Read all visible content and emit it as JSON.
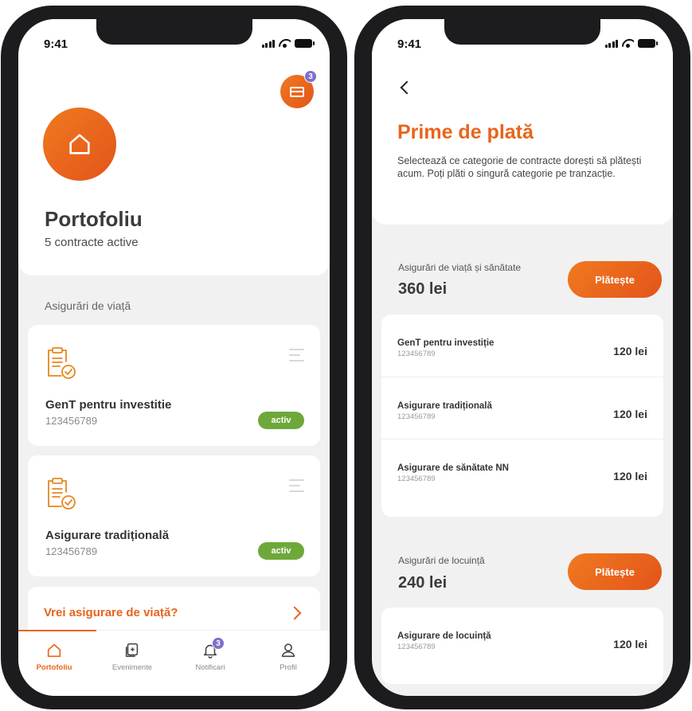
{
  "status": {
    "time": "9:41"
  },
  "portfolio": {
    "cart_badge": "3",
    "title": "Portofoliu",
    "subtitle": "5 contracte active",
    "section_label": "Asigurări de viață",
    "contracts": [
      {
        "name": "GenT pentru  investitie",
        "number": "123456789",
        "status": "activ"
      },
      {
        "name": "Asigurare tradițională",
        "number": "123456789",
        "status": "activ"
      }
    ],
    "promo_text": "Vrei asigurare de viață?",
    "tabs": [
      {
        "label": "Portofoliu",
        "icon": "home-icon",
        "active": true
      },
      {
        "label": "Evenimente",
        "icon": "document-plus-icon",
        "active": false
      },
      {
        "label": "Notificari",
        "icon": "bell-icon",
        "active": false,
        "badge": "3"
      },
      {
        "label": "Profil",
        "icon": "user-icon",
        "active": false
      }
    ]
  },
  "payments": {
    "title": "Prime de plată",
    "description": "Selectează ce categorie de contracte dorești să plătești acum. Poți plăti o singură categorie pe tranzacție.",
    "groups": [
      {
        "label": "Asigurări de viață și sănătate",
        "amount": "360 lei",
        "pay_label": "Plătește",
        "items": [
          {
            "name": "GenT pentru investiție",
            "number": "123456789",
            "amount": "120 lei"
          },
          {
            "name": "Asigurare tradițională",
            "number": "123456789",
            "amount": "120 lei"
          },
          {
            "name": "Asigurare de sănătate NN",
            "number": "123456789",
            "amount": "120 lei"
          }
        ]
      },
      {
        "label": "Asigurări de locuință",
        "amount": "240 lei",
        "pay_label": "Plătește",
        "items": [
          {
            "name": "Asigurare de locuință",
            "number": "123456789",
            "amount": "120 lei"
          }
        ]
      }
    ]
  },
  "colors": {
    "accent": "#e8641c",
    "active_badge": "#6ea83a",
    "notification_badge": "#7e6fd0"
  }
}
